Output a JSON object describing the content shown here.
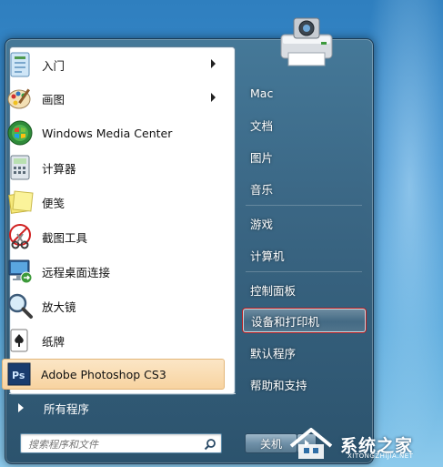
{
  "start_menu": {
    "programs": [
      {
        "label": "入门",
        "icon": "getting-started-icon",
        "has_submenu": true
      },
      {
        "label": "画图",
        "icon": "paint-icon",
        "has_submenu": true
      },
      {
        "label": "Windows Media Center",
        "icon": "media-center-icon",
        "has_submenu": false
      },
      {
        "label": "计算器",
        "icon": "calculator-icon",
        "has_submenu": false
      },
      {
        "label": "便笺",
        "icon": "sticky-notes-icon",
        "has_submenu": false
      },
      {
        "label": "截图工具",
        "icon": "snipping-tool-icon",
        "has_submenu": false
      },
      {
        "label": "远程桌面连接",
        "icon": "remote-desktop-icon",
        "has_submenu": false
      },
      {
        "label": "放大镜",
        "icon": "magnifier-icon",
        "has_submenu": false
      },
      {
        "label": "纸牌",
        "icon": "solitaire-icon",
        "has_submenu": false
      },
      {
        "label": "Adobe Photoshop CS3",
        "icon": "photoshop-icon",
        "has_submenu": false,
        "highlighted": true
      }
    ],
    "all_programs_label": "所有程序",
    "search_placeholder": "搜索程序和文件",
    "right_items": [
      {
        "label": "Mac"
      },
      {
        "label": "文档"
      },
      {
        "label": "图片"
      },
      {
        "label": "音乐"
      },
      {
        "label": "游戏"
      },
      {
        "label": "计算机"
      },
      {
        "label": "控制面板"
      },
      {
        "label": "设备和打印机",
        "highlighted": true
      },
      {
        "label": "默认程序"
      },
      {
        "label": "帮助和支持"
      }
    ],
    "shutdown_label": "关机",
    "user_picture": "devices-printer-icon"
  },
  "watermark": {
    "title": "系统之家",
    "url": "XITONGZHIJIA.NET"
  },
  "colors": {
    "highlight_orange": "#f8d3a0",
    "frame_blue": "#3a6480",
    "red_circle": "#c81414"
  }
}
